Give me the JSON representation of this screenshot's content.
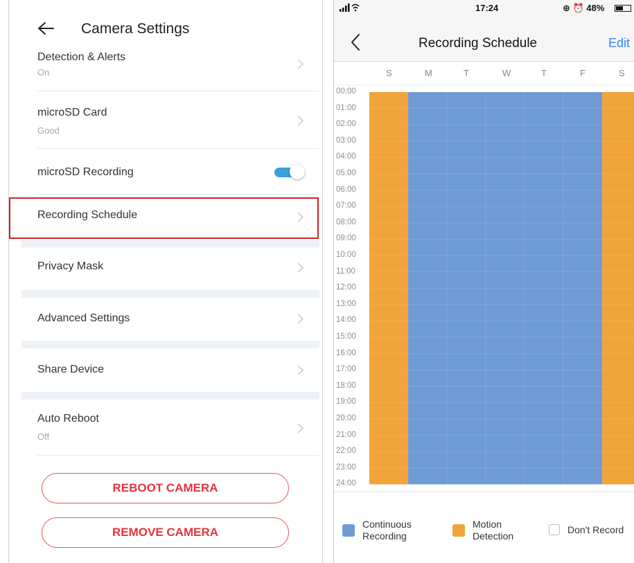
{
  "left": {
    "title": "Camera Settings",
    "items": [
      {
        "label": "Detection & Alerts",
        "value": "On"
      },
      {
        "label": "microSD Card",
        "value": "Good"
      },
      {
        "label": "microSD Recording",
        "toggle": true
      },
      {
        "label": "Recording Schedule"
      },
      {
        "label": "Privacy Mask"
      },
      {
        "label": "Advanced Settings"
      },
      {
        "label": "Share Device"
      },
      {
        "label": "Auto Reboot",
        "value": "Off"
      }
    ],
    "reboot_label": "REBOOT CAMERA",
    "remove_label": "REMOVE CAMERA",
    "accent_color": "#e8343b",
    "highlight_color": "#c62828"
  },
  "right": {
    "status": {
      "time": "17:24",
      "right": "⊕ ⏰ 48%",
      "battery_level": 0.48
    },
    "title": "Recording Schedule",
    "edit_label": "Edit",
    "days": [
      "S",
      "M",
      "T",
      "W",
      "T",
      "F",
      "S"
    ],
    "hours": [
      "00:00",
      "01:00",
      "02:00",
      "03:00",
      "04:00",
      "05:00",
      "06:00",
      "07:00",
      "08:00",
      "09:00",
      "10:00",
      "11:00",
      "12:00",
      "13:00",
      "14:00",
      "15:00",
      "16:00",
      "17:00",
      "18:00",
      "19:00",
      "20:00",
      "21:00",
      "22:00",
      "23:00",
      "24:00"
    ],
    "schedule": [
      "motion",
      "continuous",
      "continuous",
      "continuous",
      "continuous",
      "continuous",
      "motion"
    ],
    "legend": {
      "continuous_line1": "Continuous",
      "continuous_line2": "Recording",
      "motion_line1": "Motion",
      "motion_line2": "Detection",
      "none": "Don't Record"
    },
    "colors": {
      "continuous": "#6e9bd3",
      "motion": "#f0a43a",
      "link": "#2f86f6"
    }
  }
}
